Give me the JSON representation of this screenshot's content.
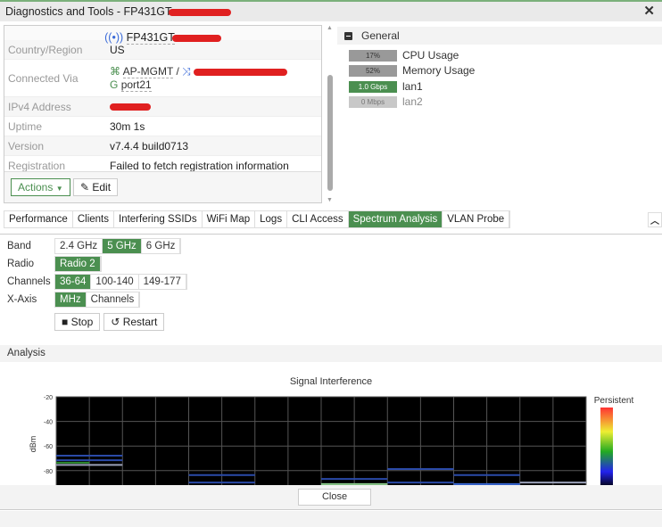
{
  "window": {
    "title": "Diagnostics and Tools - FP431GT",
    "close_icon": "close-icon"
  },
  "ap": {
    "name": "FP431GT",
    "rows": [
      {
        "label": "Country/Region",
        "value": "US"
      },
      {
        "label": "Connected Via",
        "value": "AP-MGMT",
        "sep": "/",
        "port": "port21"
      },
      {
        "label": "IPv4 Address",
        "value": ""
      },
      {
        "label": "Uptime",
        "value": "30m 1s"
      },
      {
        "label": "Version",
        "value": "v7.4.4 build0713"
      },
      {
        "label": "Registration",
        "value": "Failed to fetch registration information"
      }
    ],
    "actions_label": "Actions",
    "edit_label": "Edit"
  },
  "general": {
    "title": "General",
    "stats": [
      {
        "bar": "17%",
        "label": "CPU Usage",
        "percent": 17,
        "color": "#999999"
      },
      {
        "bar": "52%",
        "label": "Memory Usage",
        "percent": 52,
        "color": "#999999"
      },
      {
        "bar": "1.0 Gbps",
        "label": "lan1",
        "color": "#4b8f50"
      },
      {
        "bar": "0 Mbps",
        "label": "lan2",
        "color": "#c8c8c8"
      }
    ]
  },
  "tabs": [
    "Performance",
    "Clients",
    "Interfering SSIDs",
    "WiFi Map",
    "Logs",
    "CLI Access",
    "Spectrum Analysis",
    "VLAN Probe"
  ],
  "active_tab": "Spectrum Analysis",
  "form": {
    "band": {
      "label": "Band",
      "options": [
        "2.4 GHz",
        "5 GHz",
        "6 GHz"
      ],
      "selected": "5 GHz"
    },
    "radio": {
      "label": "Radio",
      "options": [
        "Radio 2"
      ],
      "selected": "Radio 2"
    },
    "channels": {
      "label": "Channels",
      "options": [
        "36-64",
        "100-140",
        "149-177"
      ],
      "selected": "36-64"
    },
    "xaxis": {
      "label": "X-Axis",
      "options": [
        "MHz",
        "Channels"
      ],
      "selected": "MHz"
    },
    "stop_label": "Stop",
    "restart_label": "Restart"
  },
  "analysis_label": "Analysis",
  "chart_data": {
    "type": "line",
    "title": "Signal Interference",
    "ylabel": "dBm",
    "ylim": [
      -100,
      -20
    ],
    "yticks": [
      "-20",
      "-40",
      "-60",
      "-80"
    ],
    "legend_title": "Persistent",
    "x_columns": 16,
    "segments": [
      {
        "cols": [
          0,
          2
        ],
        "dbm": -67.8,
        "color": "#2a4aa8"
      },
      {
        "cols": [
          0,
          2
        ],
        "dbm": -71.5,
        "color": "#2a4aa8"
      },
      {
        "cols": [
          0,
          1
        ],
        "dbm": -73.5,
        "color": "#2e8b2e"
      },
      {
        "cols": [
          0,
          2
        ],
        "dbm": -75.3,
        "color": "#9aa0b8"
      },
      {
        "cols": [
          4,
          6
        ],
        "dbm": -83.6,
        "color": "#2a4aa8"
      },
      {
        "cols": [
          4,
          6
        ],
        "dbm": -89.7,
        "color": "#2a4aa8"
      },
      {
        "cols": [
          8,
          10
        ],
        "dbm": -86.8,
        "color": "#2a4aa8"
      },
      {
        "cols": [
          8,
          10
        ],
        "dbm": -90.9,
        "color": "#8fd08f"
      },
      {
        "cols": [
          10,
          12
        ],
        "dbm": -78.7,
        "color": "#2a4aa8"
      },
      {
        "cols": [
          10,
          12
        ],
        "dbm": -89.7,
        "color": "#2a4aa8"
      },
      {
        "cols": [
          12,
          14
        ],
        "dbm": -83.6,
        "color": "#2a4aa8"
      },
      {
        "cols": [
          12,
          14
        ],
        "dbm": -90.9,
        "color": "#3a6ad8"
      },
      {
        "cols": [
          14,
          16
        ],
        "dbm": -89.7,
        "color": "#9aa0b8"
      }
    ]
  },
  "close_label": "Close"
}
